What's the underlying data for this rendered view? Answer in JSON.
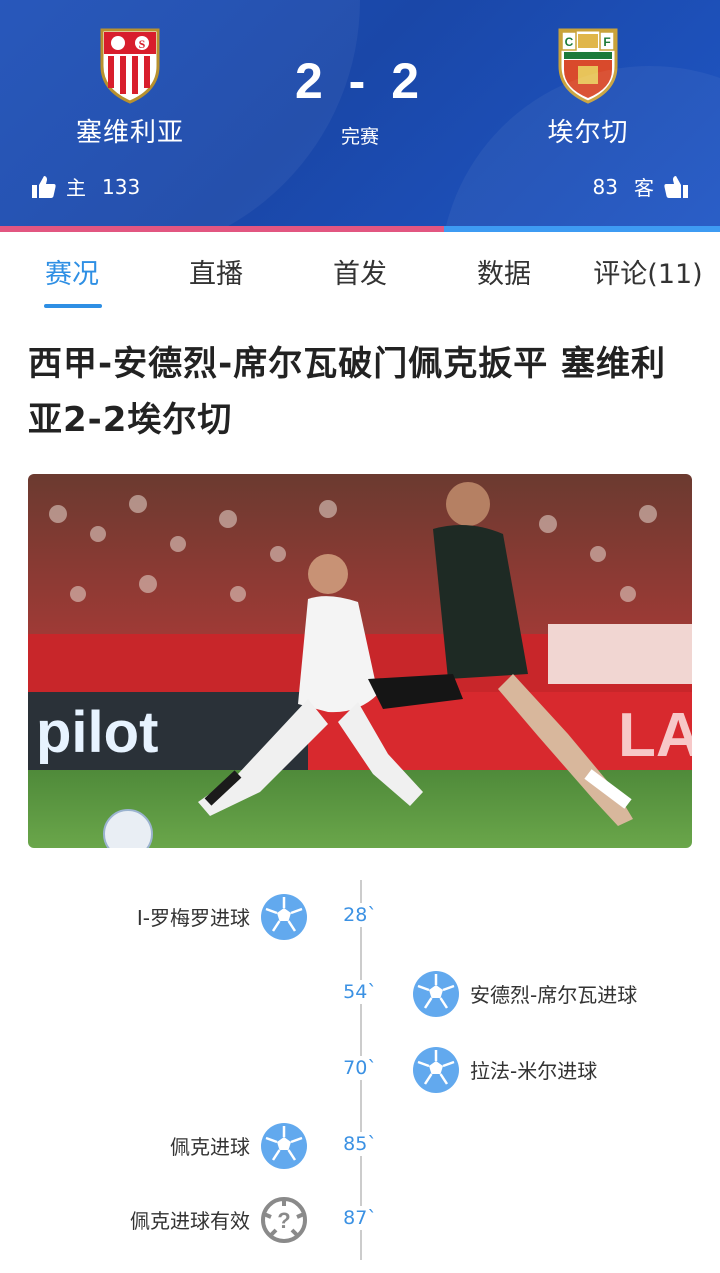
{
  "match": {
    "home": {
      "name": "塞维利亚",
      "likes_label": "主",
      "likes": "133"
    },
    "away": {
      "name": "埃尔切",
      "likes_label": "客",
      "likes": "83"
    },
    "score": "2 - 2",
    "status": "完赛",
    "home_like_fraction": 0.616
  },
  "tabs": [
    {
      "label": "赛况",
      "active": true
    },
    {
      "label": "直播"
    },
    {
      "label": "首发"
    },
    {
      "label": "数据"
    },
    {
      "label": "评论(11)"
    }
  ],
  "article": {
    "headline": "西甲-安德烈-席尔瓦破门佩克扳平 塞维利亚2-2埃尔切",
    "photo_ad_text_left": "pilot",
    "photo_ad_text_right": "LA"
  },
  "timeline": [
    {
      "minute": "28`",
      "side": "home",
      "text": "I-罗梅罗进球",
      "icon": "football-icon"
    },
    {
      "minute": "54`",
      "side": "away",
      "text": "安德烈-席尔瓦进球",
      "icon": "football-icon"
    },
    {
      "minute": "70`",
      "side": "away",
      "text": "拉法-米尔进球",
      "icon": "football-icon"
    },
    {
      "minute": "85`",
      "side": "home",
      "text": "佩克进球",
      "icon": "football-icon"
    },
    {
      "minute": "87`",
      "side": "home",
      "text": "佩克进球有效",
      "icon": "var-review-icon"
    }
  ],
  "colors": {
    "header_blue": "#1d4fb8",
    "accent": "#2e8fe4",
    "home_bar": "#e25681",
    "away_bar": "#3e9bf3",
    "ball_blue": "#62a9ee",
    "var_gray": "#888888"
  }
}
